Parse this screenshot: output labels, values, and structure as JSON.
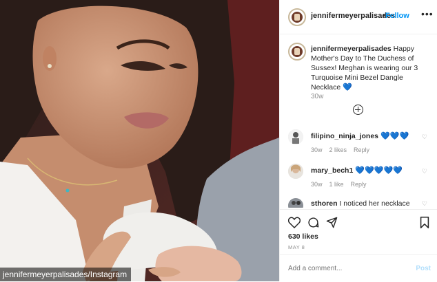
{
  "photo": {
    "credit": "jennifermeyerpalisades/Instagram"
  },
  "header": {
    "username": "jennifermeyerpalisades",
    "separator": "•",
    "follow_label": "Follow",
    "more_label": "•••"
  },
  "caption": {
    "username": "jennifermeyerpalisades",
    "text": " Happy Mother's Day to The Duchess of Sussex! Meghan is wearing our 3 Turquoise Mini Bezel Dangle Necklace ",
    "emoji": "💙",
    "time": "30w"
  },
  "comments": [
    {
      "username": "filipino_ninja_jones",
      "text": " 💙💙💙",
      "time": "30w",
      "likes": "2 likes",
      "reply": "Reply"
    },
    {
      "username": "mary_bech1",
      "text": " 💙💙💙💙💙",
      "time": "30w",
      "likes": "1 like",
      "reply": "Reply"
    },
    {
      "username": "sthoren",
      "text": " I noticed her necklace",
      "time": "",
      "likes": "",
      "reply": ""
    }
  ],
  "actions": {
    "likes": "630 likes",
    "date": "MAY 8"
  },
  "add_comment": {
    "placeholder": "Add a comment...",
    "post_label": "Post"
  },
  "colors": {
    "follow": "#0095f6",
    "post_disabled": "#b2dffc",
    "heart": "#1da1d6"
  }
}
